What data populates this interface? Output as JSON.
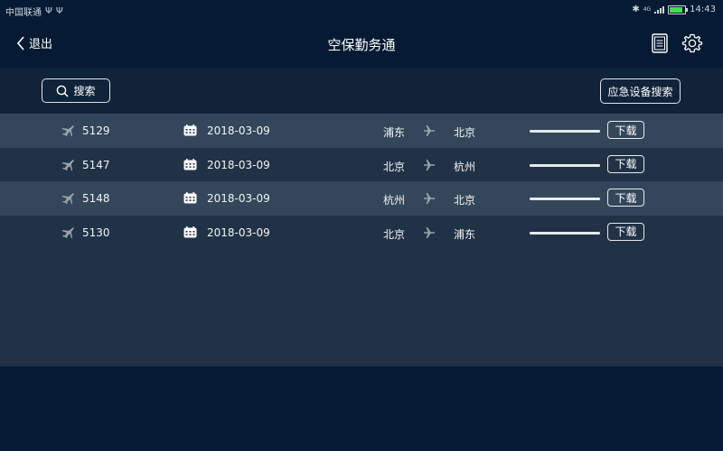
{
  "status_bar": {
    "carrier": "中国联通",
    "network": "4G",
    "time": "14:43"
  },
  "navbar": {
    "back_label": "退出",
    "title": "空保勤务通"
  },
  "toolbar": {
    "search_label": "搜索",
    "emergency_label": "应急设备搜索"
  },
  "flights": [
    {
      "flight_no": "5129",
      "date": "2018-03-09",
      "from": "浦东",
      "to": "北京",
      "download_label": "下载",
      "progress": 1.0
    },
    {
      "flight_no": "5147",
      "date": "2018-03-09",
      "from": "北京",
      "to": "杭州",
      "download_label": "下载",
      "progress": 1.0
    },
    {
      "flight_no": "5148",
      "date": "2018-03-09",
      "from": "杭州",
      "to": "北京",
      "download_label": "下载",
      "progress": 1.0
    },
    {
      "flight_no": "5130",
      "date": "2018-03-09",
      "from": "北京",
      "to": "浦东",
      "download_label": "下载",
      "progress": 1.0
    }
  ],
  "icons": {
    "back": "chevron-left-icon",
    "document": "document-icon",
    "settings": "gear-icon",
    "search": "search-icon",
    "plane": "plane-icon",
    "calendar": "calendar-icon",
    "route": "route-plane-icon"
  },
  "colors": {
    "background": "#061b33",
    "toolbar": "#112339",
    "row": "#213246",
    "row_alt": "#34475a",
    "battery": "#3ee04a"
  }
}
